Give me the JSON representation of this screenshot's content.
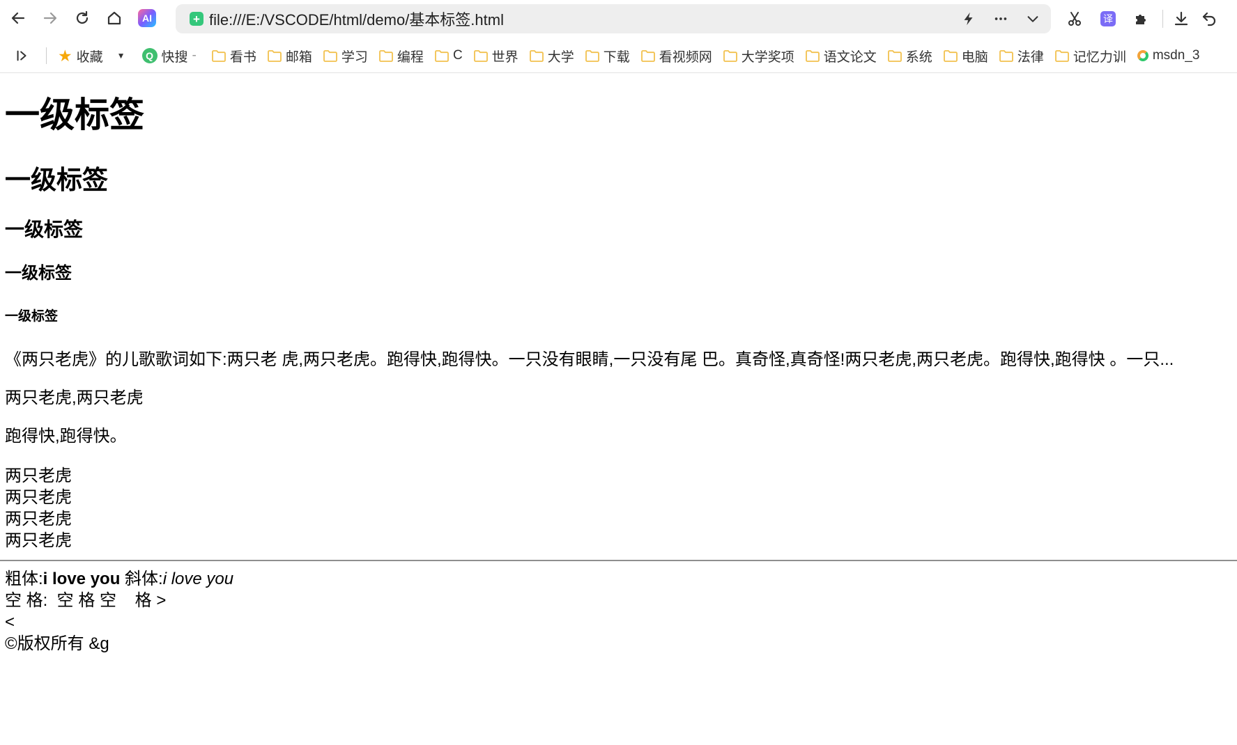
{
  "browser": {
    "url": "file:///E:/VSCODE/html/demo/基本标签.html",
    "ai_badge": "AI",
    "translate_badge": "译",
    "addr_badge": "+"
  },
  "bookmarks": {
    "favorites": "收藏",
    "quick_search": "快搜",
    "quick_search_suffix": "-",
    "quick_search_icon": "Q",
    "folders": [
      "看书",
      "邮箱",
      "学习",
      "编程",
      "C",
      "世界",
      "大学",
      "下载",
      "看视频网",
      "大学奖项",
      "语文论文",
      "系统",
      "电脑",
      "法律",
      "记忆力训"
    ],
    "msdn": "msdn_3"
  },
  "content": {
    "h1": "一级标签",
    "h2": "一级标签",
    "h3": "一级标签",
    "h4": "一级标签",
    "h5": "一级标签",
    "p_lyrics": "《两只老虎》的儿歌歌词如下:两只老 虎,两只老虎。跑得快,跑得快。一只没有眼睛,一只没有尾 巴。真奇怪,真奇怪!两只老虎,两只老虎。跑得快,跑得快 。一只...",
    "p_line2": "两只老虎,两只老虎",
    "p_line3": "跑得快,跑得快。",
    "lines": [
      "两只老虎",
      "两只老虎",
      "两只老虎",
      "两只老虎"
    ],
    "bold_label": "粗体:",
    "bold_text": "i love you",
    "italic_label": "斜体:",
    "italic_text": "i love you",
    "space_line": "空 格:  空 格 空    格 >",
    "lt_line": "<",
    "copyright_line": "©版权所有 &g"
  },
  "icons": {
    "back": "back-arrow-icon",
    "forward": "forward-arrow-icon",
    "reload": "reload-icon",
    "home": "home-icon",
    "lightning": "lightning-icon",
    "more": "more-dots-icon",
    "dropdown": "chevron-down-icon",
    "scissors": "scissors-icon",
    "extensions": "puzzle-icon",
    "download": "download-icon",
    "undo": "undo-icon",
    "folder": "folder-icon",
    "star": "star-icon"
  },
  "colors": {
    "folder": "#f2c14e",
    "star": "#f6a80a",
    "address_bg": "#eeeeee",
    "secure_badge": "#34c77b"
  }
}
